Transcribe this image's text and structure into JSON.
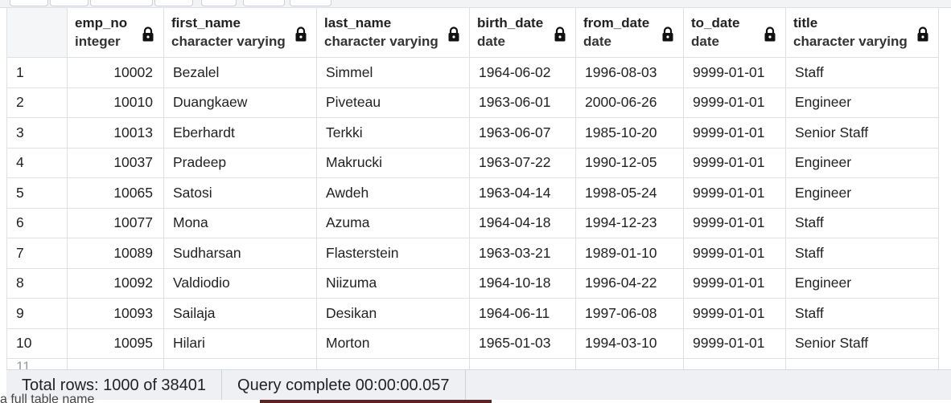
{
  "columns": [
    {
      "name": "emp_no",
      "type": "integer"
    },
    {
      "name": "first_name",
      "type": "character varying"
    },
    {
      "name": "last_name",
      "type": "character varying"
    },
    {
      "name": "birth_date",
      "type": "date"
    },
    {
      "name": "from_date",
      "type": "date"
    },
    {
      "name": "to_date",
      "type": "date"
    },
    {
      "name": "title",
      "type": "character varying"
    }
  ],
  "rows": [
    {
      "n": "1",
      "emp_no": "10002",
      "first_name": "Bezalel",
      "last_name": "Simmel",
      "birth_date": "1964-06-02",
      "from_date": "1996-08-03",
      "to_date": "9999-01-01",
      "title": "Staff"
    },
    {
      "n": "2",
      "emp_no": "10010",
      "first_name": "Duangkaew",
      "last_name": "Piveteau",
      "birth_date": "1963-06-01",
      "from_date": "2000-06-26",
      "to_date": "9999-01-01",
      "title": "Engineer"
    },
    {
      "n": "3",
      "emp_no": "10013",
      "first_name": "Eberhardt",
      "last_name": "Terkki",
      "birth_date": "1963-06-07",
      "from_date": "1985-10-20",
      "to_date": "9999-01-01",
      "title": "Senior Staff"
    },
    {
      "n": "4",
      "emp_no": "10037",
      "first_name": "Pradeep",
      "last_name": "Makrucki",
      "birth_date": "1963-07-22",
      "from_date": "1990-12-05",
      "to_date": "9999-01-01",
      "title": "Engineer"
    },
    {
      "n": "5",
      "emp_no": "10065",
      "first_name": "Satosi",
      "last_name": "Awdeh",
      "birth_date": "1963-04-14",
      "from_date": "1998-05-24",
      "to_date": "9999-01-01",
      "title": "Engineer"
    },
    {
      "n": "6",
      "emp_no": "10077",
      "first_name": "Mona",
      "last_name": "Azuma",
      "birth_date": "1964-04-18",
      "from_date": "1994-12-23",
      "to_date": "9999-01-01",
      "title": "Staff"
    },
    {
      "n": "7",
      "emp_no": "10089",
      "first_name": "Sudharsan",
      "last_name": "Flasterstein",
      "birth_date": "1963-03-21",
      "from_date": "1989-01-10",
      "to_date": "9999-01-01",
      "title": "Staff"
    },
    {
      "n": "8",
      "emp_no": "10092",
      "first_name": "Valdiodio",
      "last_name": "Niizuma",
      "birth_date": "1964-10-18",
      "from_date": "1996-04-22",
      "to_date": "9999-01-01",
      "title": "Engineer"
    },
    {
      "n": "9",
      "emp_no": "10093",
      "first_name": "Sailaja",
      "last_name": "Desikan",
      "birth_date": "1964-06-11",
      "from_date": "1997-06-08",
      "to_date": "9999-01-01",
      "title": "Staff"
    },
    {
      "n": "10",
      "emp_no": "10095",
      "first_name": "Hilari",
      "last_name": "Morton",
      "birth_date": "1965-01-03",
      "from_date": "1994-03-10",
      "to_date": "9999-01-01",
      "title": "Senior Staff"
    }
  ],
  "partial_row": {
    "n": "11"
  },
  "status": {
    "total_rows": "Total rows: 1000 of 38401",
    "query": "Query complete 00:00:00.057"
  },
  "below_text": "a full table name"
}
